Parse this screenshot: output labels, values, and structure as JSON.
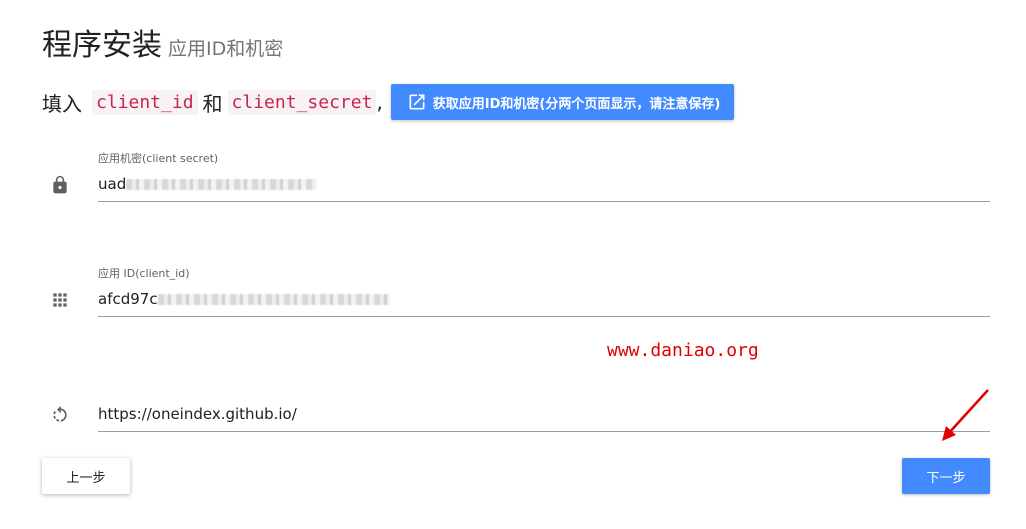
{
  "header": {
    "title": "程序安装",
    "subtitle": "应用ID和机密"
  },
  "instruction": {
    "prefix": "填入",
    "code_id": "client_id",
    "and": "和",
    "code_secret": "client_secret",
    "comma": ",",
    "get_button_label": "获取应用ID和机密(分两个页面显示，请注意保存)"
  },
  "fields": {
    "secret": {
      "label": "应用机密(client secret)",
      "value_prefix": "uad",
      "icon": "lock-icon"
    },
    "client_id": {
      "label": "应用 ID(client_id)",
      "value_prefix": "afcd97c",
      "icon": "apps-grid-icon"
    },
    "redirect": {
      "value": "https://oneindex.github.io/",
      "icon": "refresh-icon"
    }
  },
  "watermark": "www.daniao.org",
  "buttons": {
    "prev": "上一步",
    "next": "下一步"
  },
  "colors": {
    "accent": "#448aff",
    "code_text": "#c7254e",
    "watermark": "#e00000"
  }
}
